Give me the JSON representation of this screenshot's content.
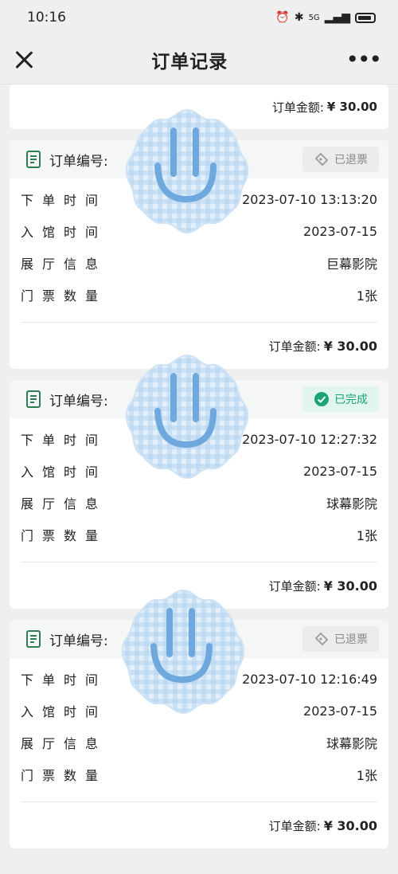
{
  "status_bar": {
    "time": "10:16",
    "network": "5G"
  },
  "nav": {
    "title": "订单记录",
    "more": "•••"
  },
  "order_header_label": "订单编号:",
  "labels": {
    "order_time": "下单时间",
    "entry_time": "入馆时间",
    "hall": "展厅信息",
    "tickets": "门票数量",
    "total": "订单金额:"
  },
  "partial_card": {
    "total": "¥ 30.00"
  },
  "orders": [
    {
      "status": "已退票",
      "status_type": "refund",
      "order_time": "2023-07-10 13:13:20",
      "entry_time": "2023-07-15",
      "hall": "巨幕影院",
      "tickets": "1张",
      "total": "¥ 30.00"
    },
    {
      "status": "已完成",
      "status_type": "done",
      "order_time": "2023-07-10 12:27:32",
      "entry_time": "2023-07-15",
      "hall": "球幕影院",
      "tickets": "1张",
      "total": "¥ 30.00"
    },
    {
      "status": "已退票",
      "status_type": "refund",
      "order_time": "2023-07-10 12:16:49",
      "entry_time": "2023-07-15",
      "hall": "球幕影院",
      "tickets": "1张",
      "total": "¥ 30.00"
    }
  ],
  "colors": {
    "done_green": "#1aa477",
    "refund_gray": "#888888",
    "doc_icon_green": "#2e7d52"
  }
}
